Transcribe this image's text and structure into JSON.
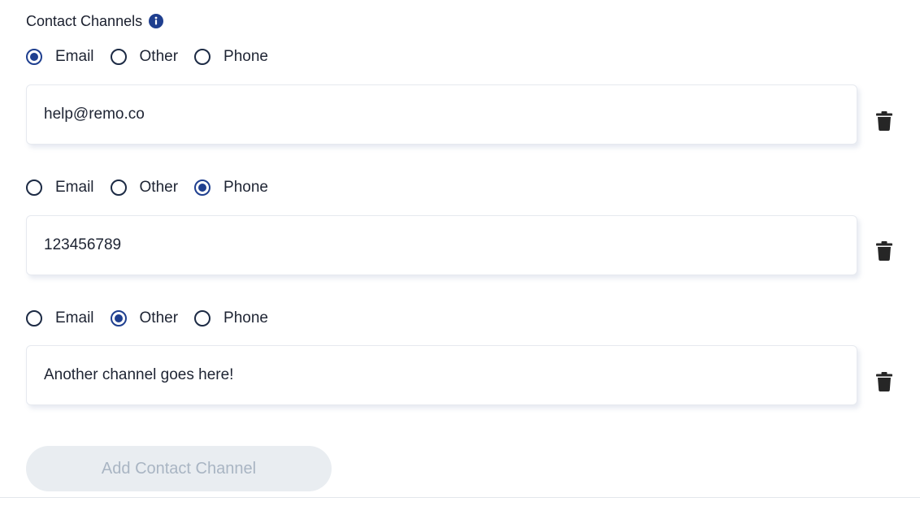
{
  "section": {
    "title": "Contact Channels",
    "info_icon": "info-icon",
    "delete_icon": "trash-icon",
    "accent_color": "#1f3f8f"
  },
  "options": [
    "Email",
    "Other",
    "Phone"
  ],
  "channels": [
    {
      "selected": "Email",
      "value": "help@remo.co",
      "placeholder": ""
    },
    {
      "selected": "Phone",
      "value": "123456789",
      "placeholder": ""
    },
    {
      "selected": "Other",
      "value": "Another channel goes here!",
      "placeholder": ""
    }
  ],
  "add_button": {
    "label": "Add Contact Channel",
    "disabled": true
  }
}
